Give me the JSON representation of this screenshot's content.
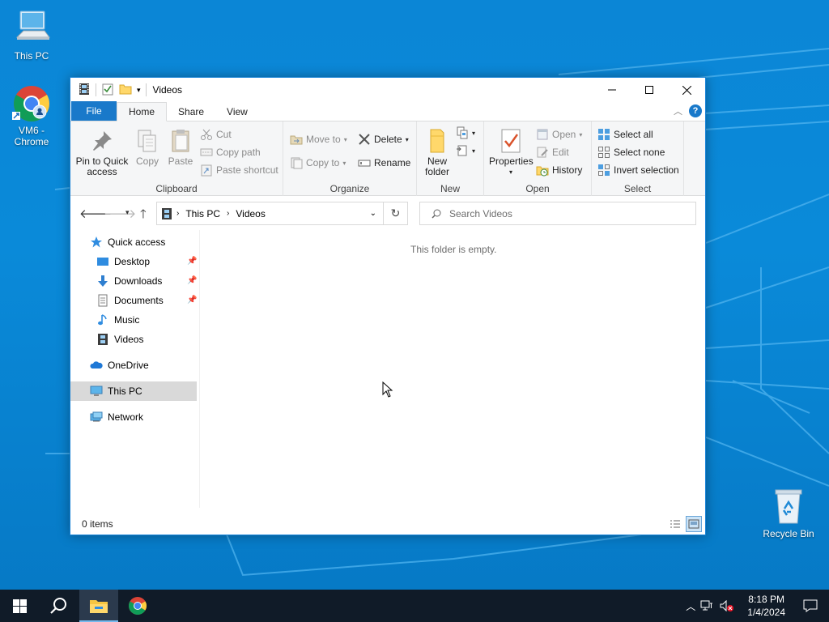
{
  "desktop": {
    "icons": [
      {
        "label": "This PC"
      },
      {
        "label": "VM6 - Chrome"
      },
      {
        "label": "Recycle Bin"
      }
    ]
  },
  "window": {
    "title": "Videos",
    "tabs": {
      "file": "File",
      "home": "Home",
      "share": "Share",
      "view": "View"
    },
    "help": "?"
  },
  "ribbon": {
    "clipboard": {
      "label": "Clipboard",
      "pin": "Pin to Quick access",
      "copy": "Copy",
      "paste": "Paste",
      "cut": "Cut",
      "copy_path": "Copy path",
      "paste_shortcut": "Paste shortcut"
    },
    "organize": {
      "label": "Organize",
      "move_to": "Move to",
      "copy_to": "Copy to",
      "delete": "Delete",
      "rename": "Rename"
    },
    "new": {
      "label": "New",
      "new_folder": "New folder"
    },
    "open": {
      "label": "Open",
      "properties": "Properties",
      "open": "Open",
      "edit": "Edit",
      "history": "History"
    },
    "select": {
      "label": "Select",
      "select_all": "Select all",
      "select_none": "Select none",
      "invert": "Invert selection"
    }
  },
  "address": {
    "crumbs": [
      "This PC",
      "Videos"
    ],
    "search_placeholder": "Search Videos"
  },
  "navpane": {
    "quick_access": "Quick access",
    "desktop": "Desktop",
    "downloads": "Downloads",
    "documents": "Documents",
    "music": "Music",
    "videos": "Videos",
    "onedrive": "OneDrive",
    "this_pc": "This PC",
    "network": "Network"
  },
  "content": {
    "empty_message": "This folder is empty."
  },
  "status": {
    "items": "0 items"
  },
  "taskbar": {
    "time": "8:18 PM",
    "date": "1/4/2024"
  },
  "colors": {
    "accent": "#1979ca",
    "taskbar": "#101b28",
    "desktop": "#0a86d6"
  }
}
